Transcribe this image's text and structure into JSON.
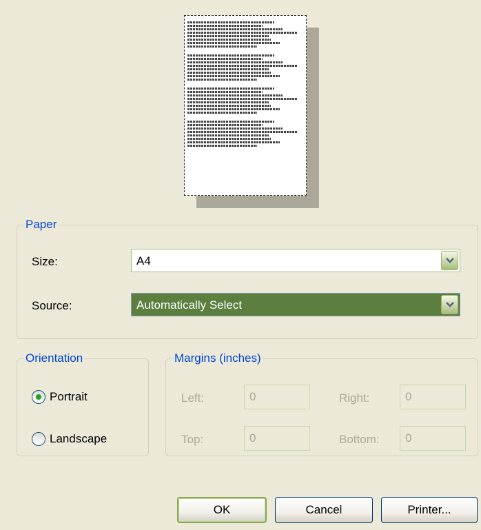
{
  "preview": {
    "line_groups": 4,
    "lines_per_group": 8
  },
  "paper": {
    "title": "Paper",
    "size_label": "Size:",
    "size_value": "A4",
    "source_label": "Source:",
    "source_value": "Automatically Select"
  },
  "orientation": {
    "title": "Orientation",
    "portrait_label": "Portrait",
    "landscape_label": "Landscape",
    "selected": "Portrait"
  },
  "margins": {
    "title": "Margins (inches)",
    "left_label": "Left:",
    "left_value": "0",
    "right_label": "Right:",
    "right_value": "0",
    "top_label": "Top:",
    "top_value": "0",
    "bottom_label": "Bottom:",
    "bottom_value": "0"
  },
  "buttons": {
    "ok": "OK",
    "cancel": "Cancel",
    "printer": "Printer..."
  },
  "colors": {
    "background": "#ECE9D8",
    "group_title": "#0046D5",
    "selected_fill": "#5C7E3F",
    "disabled_text": "#ACA899"
  }
}
